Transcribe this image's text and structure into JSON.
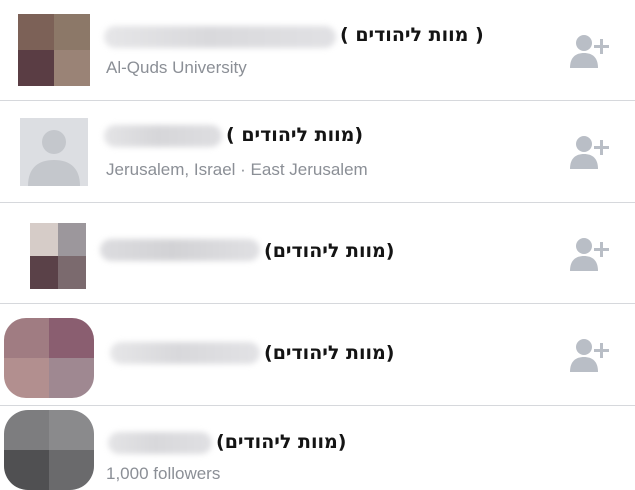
{
  "people": [
    {
      "name_suffix": "( מוות ליהודים )",
      "subtitle": "Al-Quds University",
      "avatar_type": "mosaic",
      "avatar_colors": [
        "#7c6157",
        "#8c7868",
        "#5a3d44",
        "#9a8376"
      ],
      "name_blur_colors": [
        "#e6e6e8",
        "#d9d9dc",
        "#e1e1e4"
      ]
    },
    {
      "name_suffix": "( מוות ליהודים)",
      "subtitle": "Jerusalem, Israel · East Jerusalem",
      "avatar_type": "silhouette",
      "avatar_colors": [
        "#dcdee2",
        "#c4c7cc"
      ],
      "name_blur_colors": [
        "#e4e4e6",
        "#d6d6d9",
        "#dedee1"
      ]
    },
    {
      "name_suffix": "(מוות ליהודים)",
      "subtitle": "",
      "avatar_type": "mosaic",
      "avatar_colors": [
        "#d6ccc8",
        "#9c979c",
        "#5a4148",
        "#7b6a6e"
      ],
      "name_blur_colors": [
        "#dcdcdf",
        "#d2d2d5",
        "#e0e0e3"
      ]
    },
    {
      "name_suffix": "(מוות ליהודים)",
      "subtitle": "",
      "avatar_type": "mosaic",
      "avatar_colors": [
        "#a07c82",
        "#8a5e70",
        "#b28f8f",
        "#9f8891"
      ],
      "name_blur_colors": [
        "#e6e6e8",
        "#d8d8db",
        "#e2e2e5"
      ]
    },
    {
      "name_suffix": "(מוות ליהודים)",
      "subtitle": "1,000 followers",
      "avatar_type": "mosaic",
      "avatar_colors": [
        "#7d7d7f",
        "#8a8a8c",
        "#505052",
        "#6a6a6c"
      ],
      "name_blur_colors": [
        "#e4e4e6",
        "#d8d8db",
        "#e0e0e3"
      ]
    }
  ],
  "colors": {
    "add_icon": "#b9bec6",
    "separator": "#d6d8dc",
    "subtitle": "#8b8f96",
    "name": "#141414"
  },
  "icons": {
    "add_friend": "add-friend-icon"
  }
}
